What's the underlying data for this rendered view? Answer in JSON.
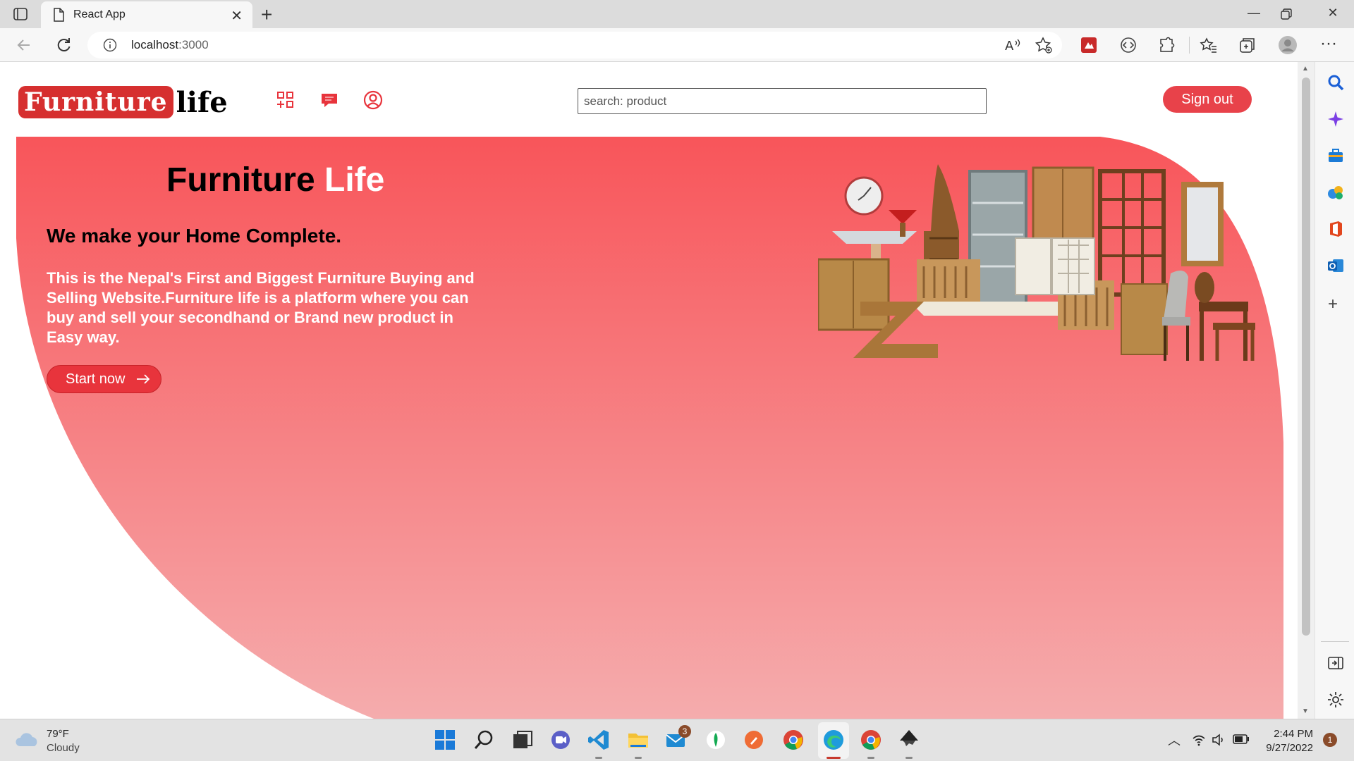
{
  "browser": {
    "tab_title": "React App",
    "url_host": "localhost",
    "url_port": ":3000"
  },
  "site": {
    "logo_box": "Furniture",
    "logo_rest": "life",
    "search_placeholder": "search: product",
    "signout_label": "Sign out"
  },
  "hero": {
    "title_main": "Furniture",
    "title_accent": "Life",
    "subtitle": "We make your Home Complete.",
    "description": "This is the Nepal's First and Biggest Furniture Buying and Selling Website.Furniture life is a platform where you can buy and sell your secondhand or Brand new product in Easy way.",
    "cta_label": "Start now"
  },
  "taskbar": {
    "weather_temp": "79°F",
    "weather_condition": "Cloudy",
    "mail_badge": "3",
    "time": "2:44 PM",
    "date": "9/27/2022",
    "notification_count": "1"
  },
  "colors": {
    "brand_red": "#d62f2f",
    "hero_top": "#f8585c",
    "hero_bottom": "#f5aaac",
    "button_red": "#e8424a"
  }
}
